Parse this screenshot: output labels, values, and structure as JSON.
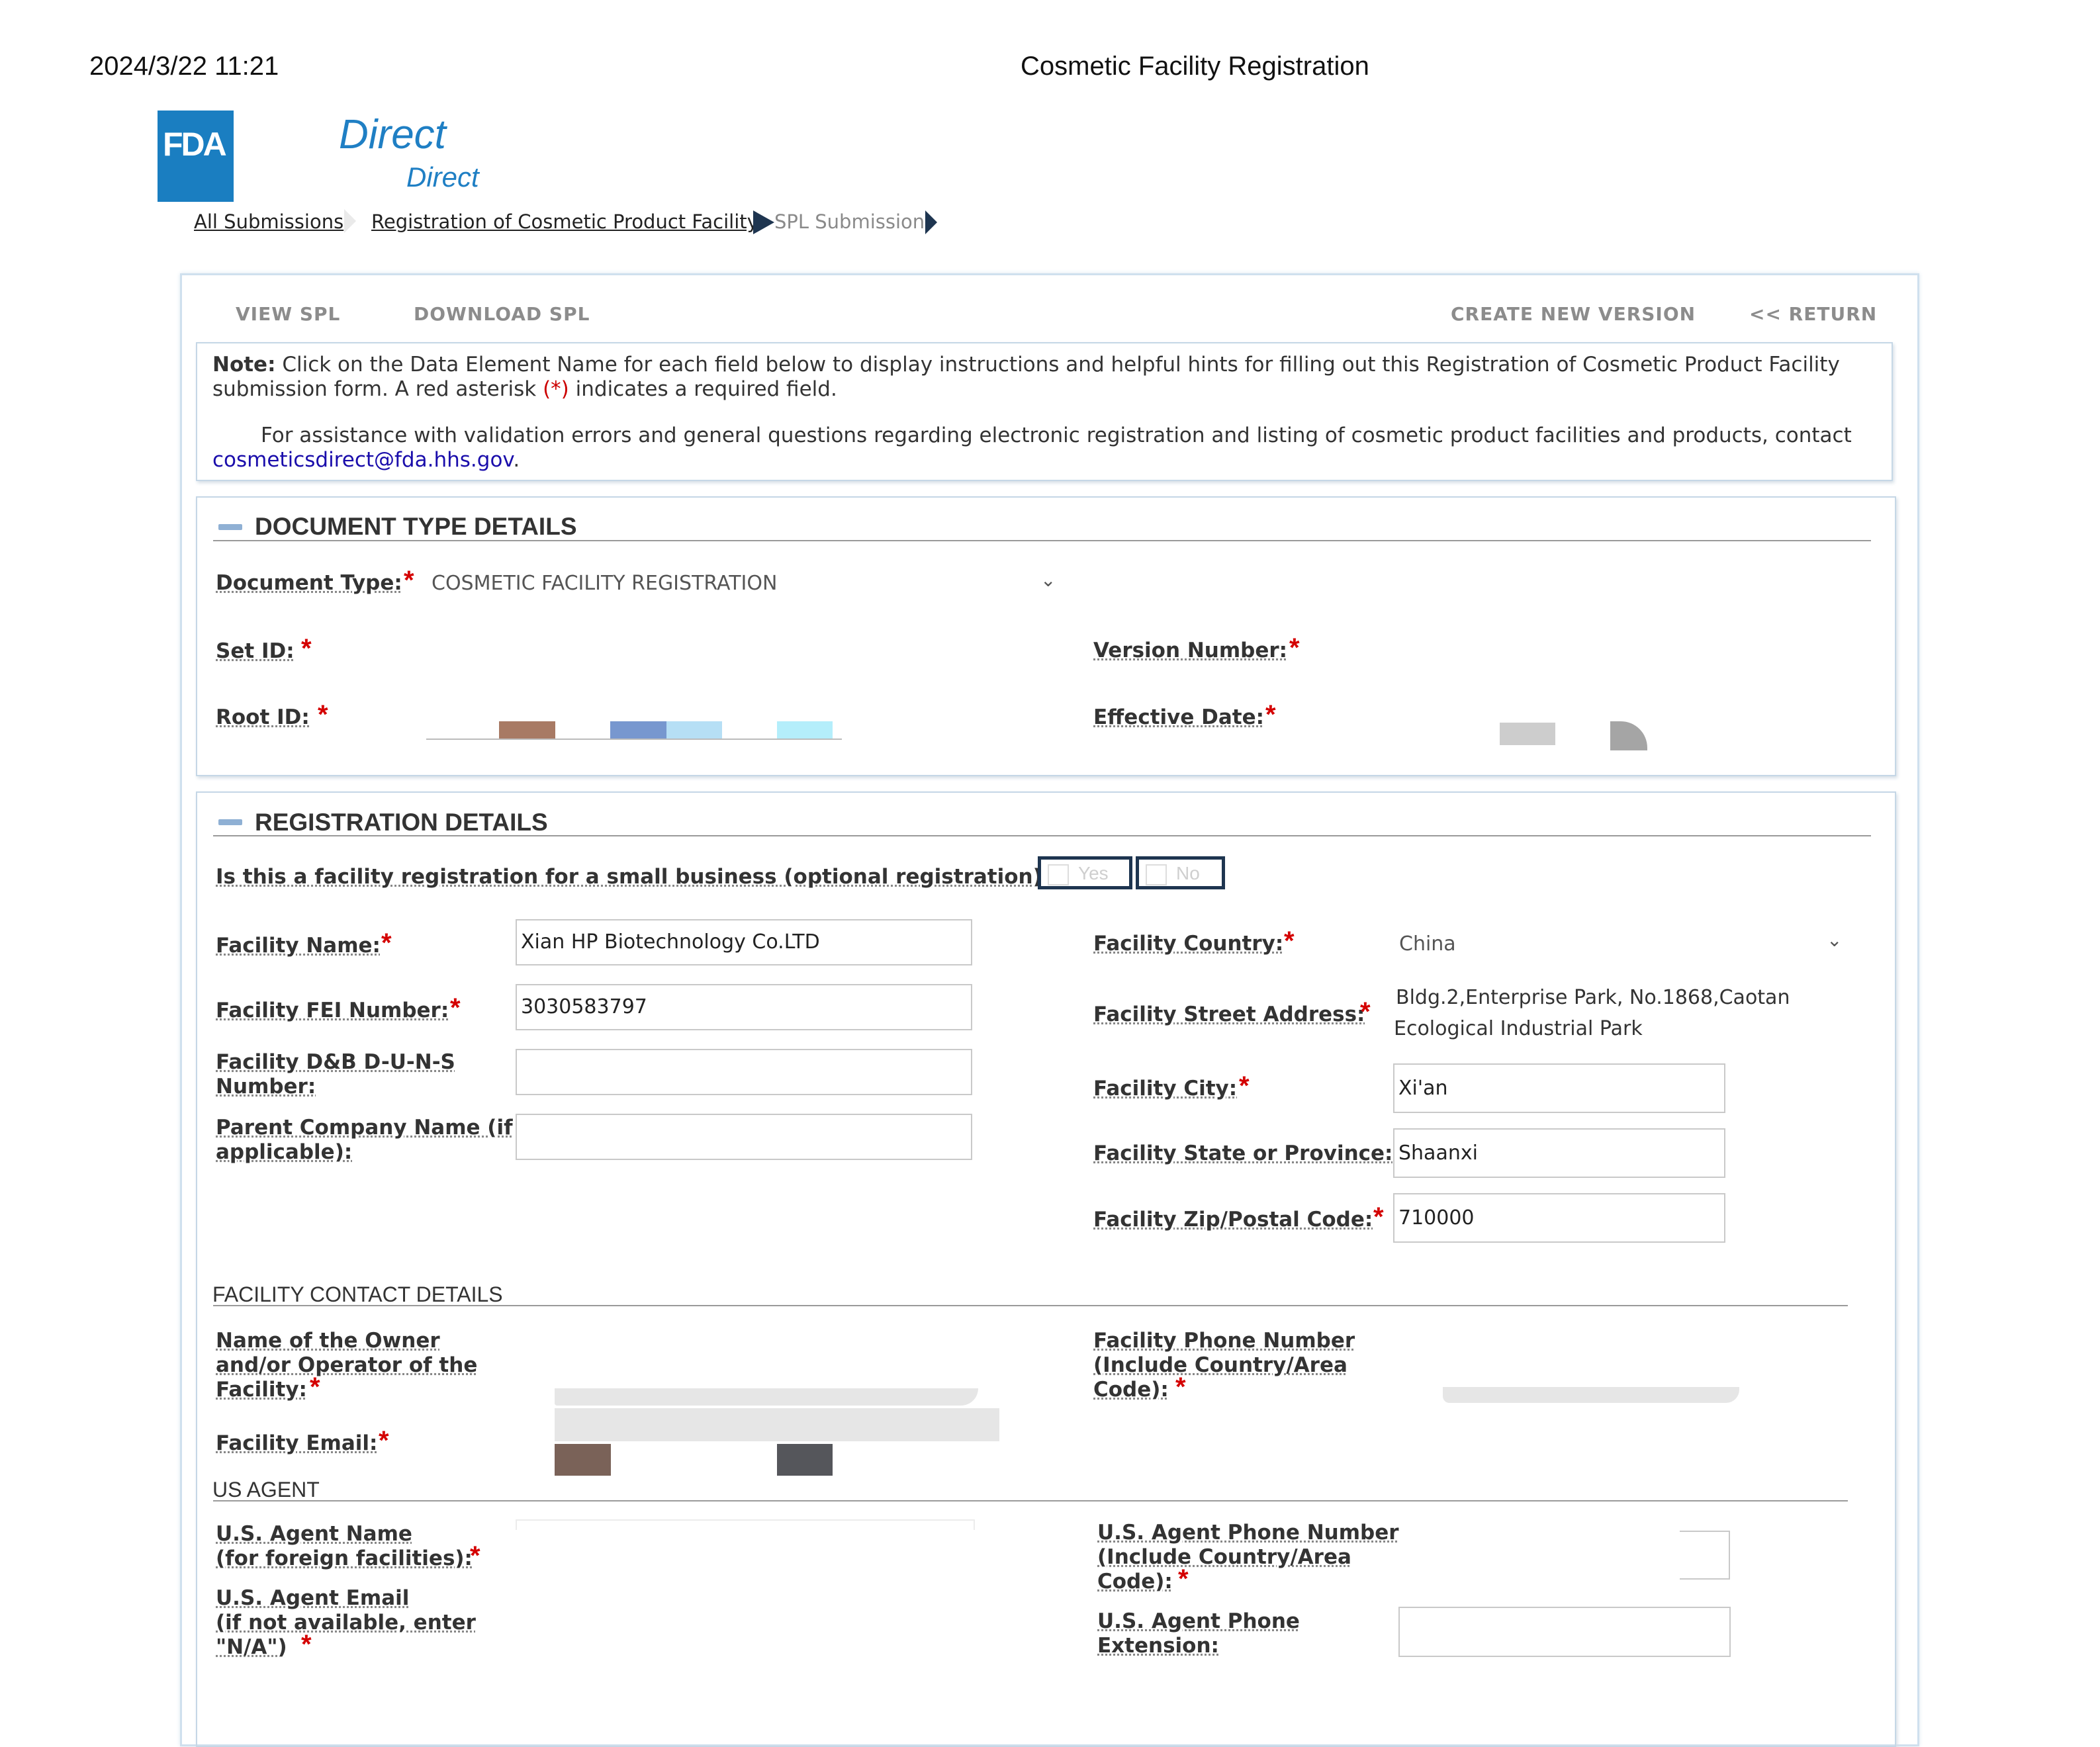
{
  "print_header": {
    "date": "2024/3/22 11:21",
    "title": "Cosmetic Facility Registration"
  },
  "logo": {
    "fda": "FDA",
    "direct_large": "Direct",
    "direct_small": "Direct"
  },
  "breadcrumb": [
    "All Submissions",
    "Registration of Cosmetic Product Facility",
    "SPL Submission"
  ],
  "toolbar": {
    "view_spl": "VIEW SPL",
    "download_spl": "DOWNLOAD SPL",
    "create_new_version": "CREATE NEW VERSION",
    "return": "<< RETURN"
  },
  "note": {
    "bold": "Note:",
    "text_a": " Click on the Data Element Name for each field below to display instructions and helpful hints for filling out this Registration of Cosmetic Product Facility submission form. A red asterisk ",
    "asterisk": "(*)",
    "text_b": " indicates a required field.",
    "assist": "For assistance with validation errors and general questions regarding electronic registration and listing of cosmetic product facilities and products, contact ",
    "email": "cosmeticsdirect@fda.hhs.gov",
    "period": "."
  },
  "document_type_section": {
    "title": "DOCUMENT TYPE DETAILS",
    "document_type_label": "Document Type:",
    "document_type_value": "COSMETIC FACILITY REGISTRATION",
    "set_id_label": "Set ID:",
    "root_id_label": "Root ID:",
    "version_number_label": "Version Number:",
    "effective_date_label": "Effective Date:"
  },
  "registration_section": {
    "title": "REGISTRATION DETAILS",
    "small_business_question": "Is this a facility registration for a small business (optional registration)?:",
    "yes": "Yes",
    "no": "No",
    "facility_name_label": "Facility Name:",
    "facility_name_value": "Xian HP Biotechnology Co.LTD",
    "fei_label": "Facility FEI Number:",
    "fei_value": "3030583797",
    "duns_label_1": "Facility D&B D-U-N-S",
    "duns_label_2": "Number:",
    "parent_label_1": "Parent Company Name (if",
    "parent_label_2": "applicable):",
    "country_label": "Facility Country:",
    "country_value": "China",
    "street_label": "Facility Street Address:",
    "street_line_1": "Bldg.2,Enterprise Park, No.1868,Caotan",
    "street_line_2": "Ecological Industrial Park",
    "city_label": "Facility City:",
    "city_value": "Xi'an",
    "state_label": "Facility State or Province:",
    "state_value": "Shaanxi",
    "zip_label": "Facility Zip/Postal Code:",
    "zip_value": "710000"
  },
  "contact_section": {
    "title": "FACILITY CONTACT DETAILS",
    "owner_label_1": "Name of the Owner",
    "owner_label_2": "and/or Operator of the",
    "owner_label_3": "Facility:",
    "email_label": "Facility Email:",
    "phone_label_1": "Facility Phone Number",
    "phone_label_2": "(Include Country/Area",
    "phone_label_3": "Code):"
  },
  "us_agent_section": {
    "title": "US AGENT",
    "name_label_1": "U.S. Agent Name",
    "name_label_2": "(for foreign facilities):",
    "email_label_1": "U.S. Agent Email",
    "email_label_2": "(if not available, enter",
    "email_label_3": "\"N/A\")",
    "phone_label_1": "U.S. Agent Phone Number",
    "phone_label_2": "(Include Country/Area",
    "phone_label_3": "Code):",
    "ext_label_1": "U.S. Agent Phone",
    "ext_label_2": "Extension:"
  },
  "required_marker": "*"
}
